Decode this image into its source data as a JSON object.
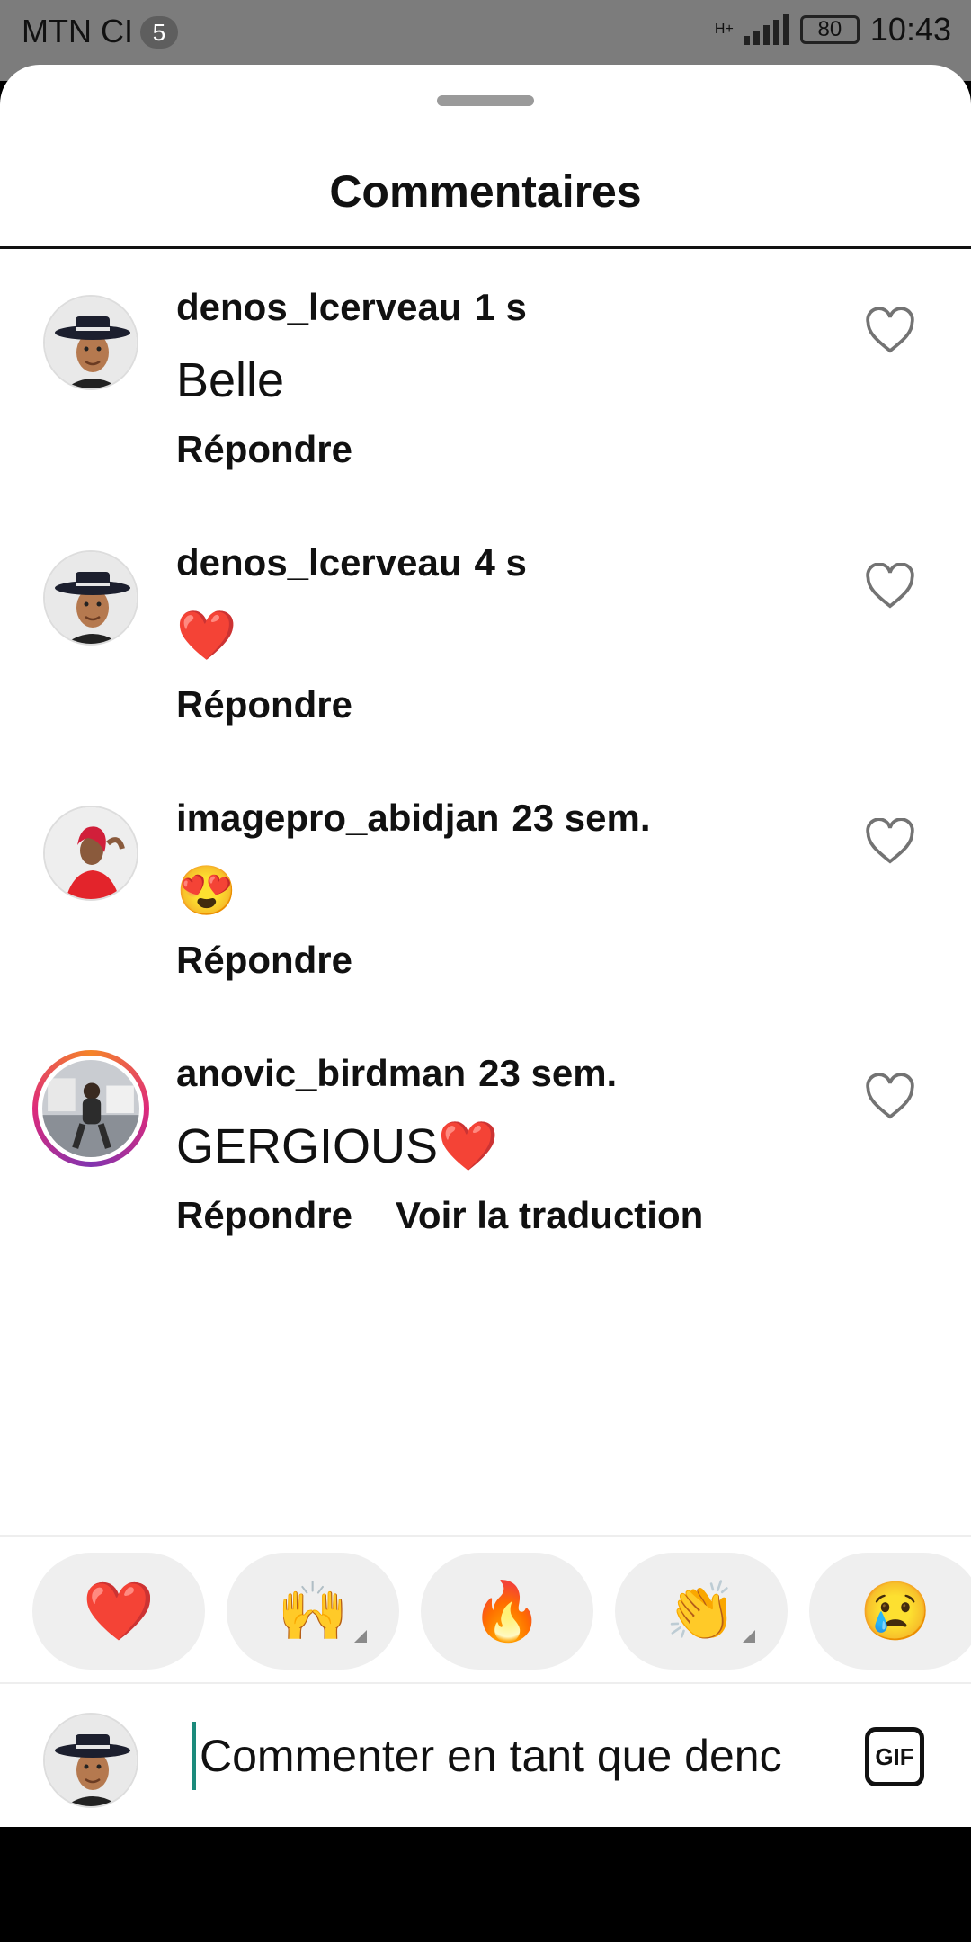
{
  "status_bar": {
    "carrier": "MTN CI",
    "badge": "5",
    "network": "H+",
    "battery": "80",
    "time": "10:43"
  },
  "sheet": {
    "title": "Commentaires"
  },
  "comments": [
    {
      "username": "denos_lcerveau",
      "time": "1 s",
      "text": "Belle",
      "reply": "Répondre",
      "translate": ""
    },
    {
      "username": "denos_lcerveau",
      "time": "4 s",
      "text": "❤️",
      "reply": "Répondre",
      "translate": ""
    },
    {
      "username": "imagepro_abidjan",
      "time": "23 sem.",
      "text": "😍",
      "reply": "Répondre",
      "translate": ""
    },
    {
      "username": "anovic_birdman",
      "time": "23 sem.",
      "text": "GERGIOUS❤️",
      "reply": "Répondre",
      "translate": "Voir la traduction"
    }
  ],
  "emoji_bar": {
    "emojis": [
      "❤️",
      "🙌",
      "🔥",
      "👏",
      "😢"
    ]
  },
  "composer": {
    "placeholder": "Commenter en tant que denos_lcerveau...",
    "visible_text": "Commenter en tant que denc",
    "gif_label": "GIF"
  },
  "colors": {
    "accent_cursor": "#1b8a7b",
    "story_ring": [
      "#f58529",
      "#dd2a7b",
      "#8134af"
    ]
  }
}
